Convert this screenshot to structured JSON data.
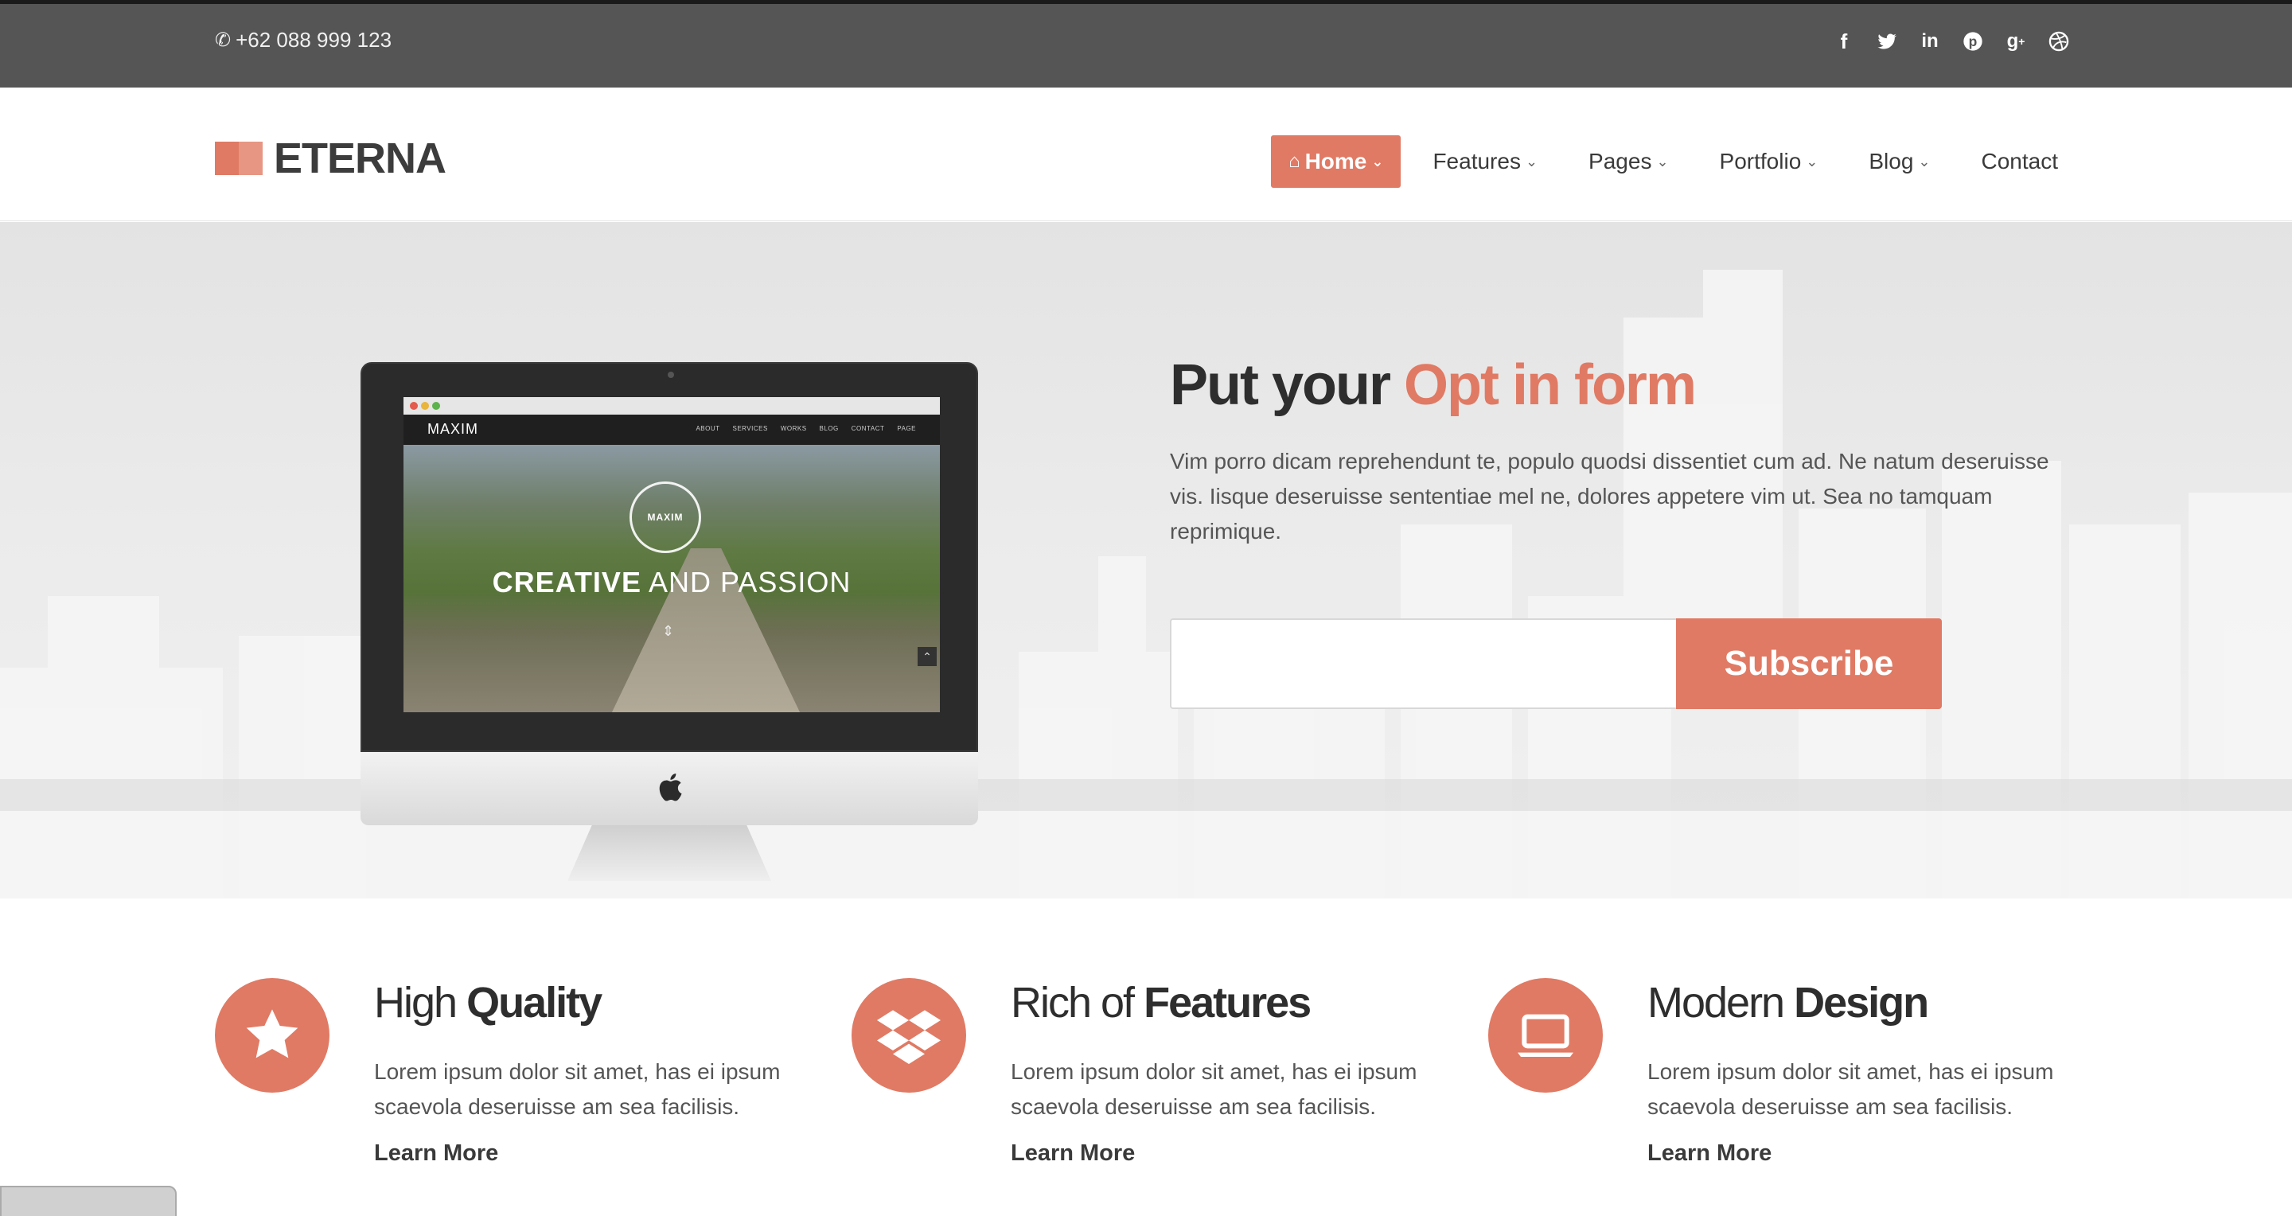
{
  "topbar": {
    "phone": "+62 088 999 123",
    "phone_icon": "phone-icon",
    "social": [
      "facebook-icon",
      "twitter-icon",
      "linkedin-icon",
      "pinterest-icon",
      "google-plus-icon",
      "dribbble-icon"
    ]
  },
  "header": {
    "logo": "ETERNA",
    "nav": [
      {
        "label": "Home",
        "active": true
      },
      {
        "label": "Features"
      },
      {
        "label": "Pages"
      },
      {
        "label": "Portfolio"
      },
      {
        "label": "Blog"
      },
      {
        "label": "Contact"
      }
    ]
  },
  "hero": {
    "title_plain": "Put your ",
    "title_accent": "Opt in form",
    "text": "Vim porro dicam reprehendunt te, populo quodsi dissentiet cum ad. Ne natum deseruisse vis. Iisque deseruisse sententiae mel ne, dolores appetere vim ut. Sea no tamquam reprimique.",
    "email_value": "",
    "subscribe_label": "Subscribe",
    "screen": {
      "brand": "MAXIM",
      "links": [
        "ABOUT",
        "SERVICES",
        "WORKS",
        "BLOG",
        "CONTACT",
        "PAGE"
      ],
      "badge": "MAXIM",
      "headline_bold": "CREATIVE",
      "headline_rest": " AND PASSION"
    }
  },
  "features": [
    {
      "title_light": "High ",
      "title_bold": "Quality",
      "text": "Lorem ipsum dolor sit amet, has ei ipsum scaevola deseruisse am sea facilisis.",
      "link": "Learn More",
      "icon": "star-icon"
    },
    {
      "title_light": "Rich of ",
      "title_bold": "Features",
      "text": "Lorem ipsum dolor sit amet, has ei ipsum scaevola deseruisse am sea facilisis.",
      "link": "Learn More",
      "icon": "dropbox-icon"
    },
    {
      "title_light": "Modern ",
      "title_bold": "Design",
      "text": "Lorem ipsum dolor sit amet, has ei ipsum scaevola deseruisse am sea facilisis.",
      "link": "Learn More",
      "icon": "laptop-icon"
    }
  ],
  "colors": {
    "accent": "#e07a64",
    "topbar": "#555555",
    "heading": "#2e2e2e"
  }
}
